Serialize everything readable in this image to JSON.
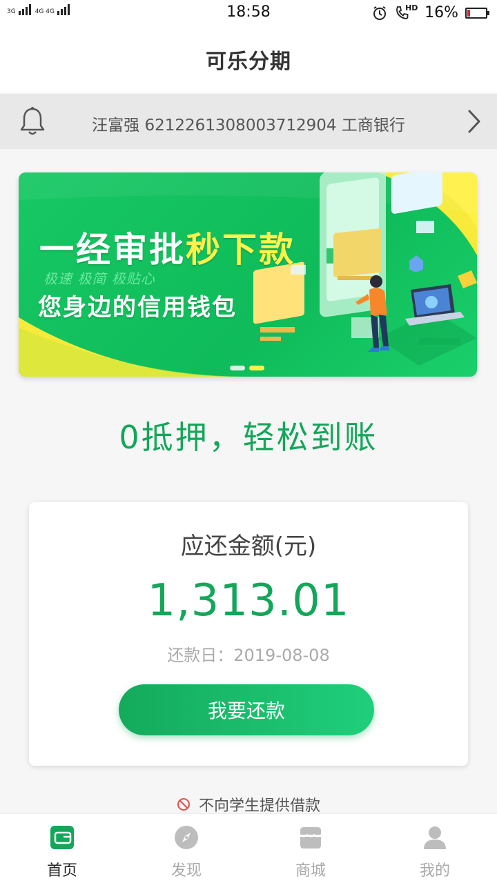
{
  "status_bar": {
    "time": "18:58",
    "net_left": "3G",
    "net_right": "4G 4G",
    "hd": "HD",
    "battery_percent": "16%",
    "battery_level": 0.16
  },
  "header": {
    "title": "可乐分期"
  },
  "notice": {
    "text": "汪富强 6212261308003712904 工商银行"
  },
  "banner": {
    "headline_part1": "一经审批",
    "headline_part2": "秒下款",
    "subline": "极速 极简 极贴心",
    "tagline": "您身边的信用钱包",
    "slide_count": 2,
    "active_slide": 2
  },
  "slogan": "0抵押，轻松到账",
  "repayment": {
    "label": "应还金额(元)",
    "amount": "1,313.01",
    "date": "还款日：2019-08-08",
    "button_label": "我要还款"
  },
  "student_notice": "不向学生提供借款",
  "tabbar": {
    "items": [
      {
        "label": "首页",
        "icon": "wallet-icon",
        "active": true
      },
      {
        "label": "发现",
        "icon": "compass-icon",
        "active": false
      },
      {
        "label": "商城",
        "icon": "store-icon",
        "active": false
      },
      {
        "label": "我的",
        "icon": "user-icon",
        "active": false
      }
    ]
  },
  "colors": {
    "accent": "#14a65a",
    "tab_active": "#14a65a",
    "tab_inactive": "#bdbdbd"
  }
}
